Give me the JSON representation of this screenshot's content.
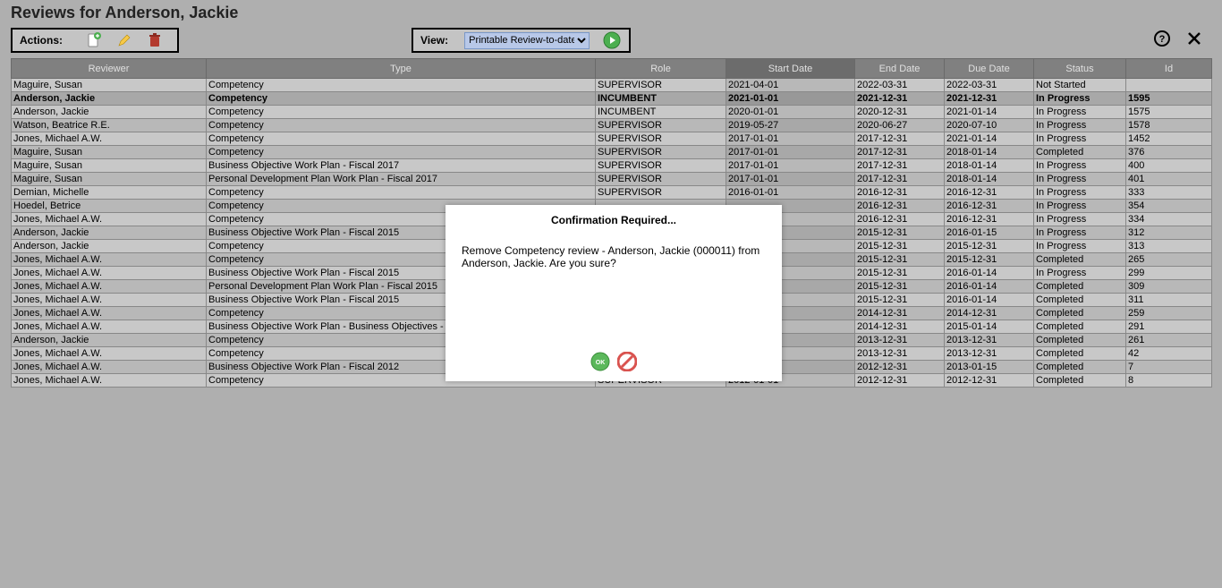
{
  "page_title": "Reviews for Anderson, Jackie",
  "toolbar": {
    "actions_label": "Actions:",
    "view_label": "View:",
    "view_selected": "Printable Review-to-date"
  },
  "columns": [
    "Reviewer",
    "Type",
    "Role",
    "Start Date",
    "End Date",
    "Due Date",
    "Status",
    "Id"
  ],
  "sort_col_index": 3,
  "selected_row_index": 1,
  "rows": [
    {
      "reviewer": "Maguire, Susan",
      "type": "Competency",
      "role": "SUPERVISOR",
      "start": "2021-04-01",
      "end": "2022-03-31",
      "due": "2022-03-31",
      "status": "Not Started",
      "id": ""
    },
    {
      "reviewer": "Anderson, Jackie",
      "type": "Competency",
      "role": "INCUMBENT",
      "start": "2021-01-01",
      "end": "2021-12-31",
      "due": "2021-12-31",
      "status": "In Progress",
      "id": "1595"
    },
    {
      "reviewer": "Anderson, Jackie",
      "type": "Competency",
      "role": "INCUMBENT",
      "start": "2020-01-01",
      "end": "2020-12-31",
      "due": "2021-01-14",
      "status": "In Progress",
      "id": "1575"
    },
    {
      "reviewer": "Watson, Beatrice R.E.",
      "type": "Competency",
      "role": "SUPERVISOR",
      "start": "2019-05-27",
      "end": "2020-06-27",
      "due": "2020-07-10",
      "status": "In Progress",
      "id": "1578"
    },
    {
      "reviewer": "Jones, Michael A.W.",
      "type": "Competency",
      "role": "SUPERVISOR",
      "start": "2017-01-01",
      "end": "2017-12-31",
      "due": "2021-01-14",
      "status": "In Progress",
      "id": "1452"
    },
    {
      "reviewer": "Maguire, Susan",
      "type": "Competency",
      "role": "SUPERVISOR",
      "start": "2017-01-01",
      "end": "2017-12-31",
      "due": "2018-01-14",
      "status": "Completed",
      "id": "376"
    },
    {
      "reviewer": "Maguire, Susan",
      "type": "Business Objective Work Plan - Fiscal 2017",
      "role": "SUPERVISOR",
      "start": "2017-01-01",
      "end": "2017-12-31",
      "due": "2018-01-14",
      "status": "In Progress",
      "id": "400"
    },
    {
      "reviewer": "Maguire, Susan",
      "type": "Personal Development Plan Work Plan - Fiscal 2017",
      "role": "SUPERVISOR",
      "start": "2017-01-01",
      "end": "2017-12-31",
      "due": "2018-01-14",
      "status": "In Progress",
      "id": "401"
    },
    {
      "reviewer": "Demian, Michelle",
      "type": "Competency",
      "role": "SUPERVISOR",
      "start": "2016-01-01",
      "end": "2016-12-31",
      "due": "2016-12-31",
      "status": "In Progress",
      "id": "333"
    },
    {
      "reviewer": "Hoedel, Betrice",
      "type": "Competency",
      "role": "",
      "start": "",
      "end": "2016-12-31",
      "due": "2016-12-31",
      "status": "In Progress",
      "id": "354"
    },
    {
      "reviewer": "Jones, Michael A.W.",
      "type": "Competency",
      "role": "",
      "start": "",
      "end": "2016-12-31",
      "due": "2016-12-31",
      "status": "In Progress",
      "id": "334"
    },
    {
      "reviewer": "Anderson, Jackie",
      "type": "Business Objective Work Plan - Fiscal 2015",
      "role": "",
      "start": "",
      "end": "2015-12-31",
      "due": "2016-01-15",
      "status": "In Progress",
      "id": "312"
    },
    {
      "reviewer": "Anderson, Jackie",
      "type": "Competency",
      "role": "",
      "start": "",
      "end": "2015-12-31",
      "due": "2015-12-31",
      "status": "In Progress",
      "id": "313"
    },
    {
      "reviewer": "Jones, Michael A.W.",
      "type": "Competency",
      "role": "",
      "start": "",
      "end": "2015-12-31",
      "due": "2015-12-31",
      "status": "Completed",
      "id": "265"
    },
    {
      "reviewer": "Jones, Michael A.W.",
      "type": "Business Objective Work Plan - Fiscal 2015",
      "role": "",
      "start": "",
      "end": "2015-12-31",
      "due": "2016-01-14",
      "status": "In Progress",
      "id": "299"
    },
    {
      "reviewer": "Jones, Michael A.W.",
      "type": "Personal Development Plan Work Plan - Fiscal 2015",
      "role": "",
      "start": "",
      "end": "2015-12-31",
      "due": "2016-01-14",
      "status": "Completed",
      "id": "309"
    },
    {
      "reviewer": "Jones, Michael A.W.",
      "type": "Business Objective Work Plan - Fiscal 2015",
      "role": "",
      "start": "",
      "end": "2015-12-31",
      "due": "2016-01-14",
      "status": "Completed",
      "id": "311"
    },
    {
      "reviewer": "Jones, Michael A.W.",
      "type": "Competency",
      "role": "",
      "start": "",
      "end": "2014-12-31",
      "due": "2014-12-31",
      "status": "Completed",
      "id": "259"
    },
    {
      "reviewer": "Jones, Michael A.W.",
      "type": "Business Objective Work Plan - Business Objectives -",
      "role": "",
      "start": "",
      "end": "2014-12-31",
      "due": "2015-01-14",
      "status": "Completed",
      "id": "291"
    },
    {
      "reviewer": "Anderson, Jackie",
      "type": "Competency",
      "role": "",
      "start": "",
      "end": "2013-12-31",
      "due": "2013-12-31",
      "status": "Completed",
      "id": "261"
    },
    {
      "reviewer": "Jones, Michael A.W.",
      "type": "Competency",
      "role": "",
      "start": "",
      "end": "2013-12-31",
      "due": "2013-12-31",
      "status": "Completed",
      "id": "42"
    },
    {
      "reviewer": "Jones, Michael A.W.",
      "type": "Business Objective Work Plan - Fiscal 2012",
      "role": "",
      "start": "",
      "end": "2012-12-31",
      "due": "2013-01-15",
      "status": "Completed",
      "id": "7"
    },
    {
      "reviewer": "Jones, Michael A.W.",
      "type": "Competency",
      "role": "SUPERVISOR",
      "start": "2012-01-01",
      "end": "2012-12-31",
      "due": "2012-12-31",
      "status": "Completed",
      "id": "8"
    }
  ],
  "modal": {
    "title": "Confirmation Required...",
    "text": "Remove Competency review - Anderson, Jackie (000011) from Anderson, Jackie. Are you sure?"
  }
}
